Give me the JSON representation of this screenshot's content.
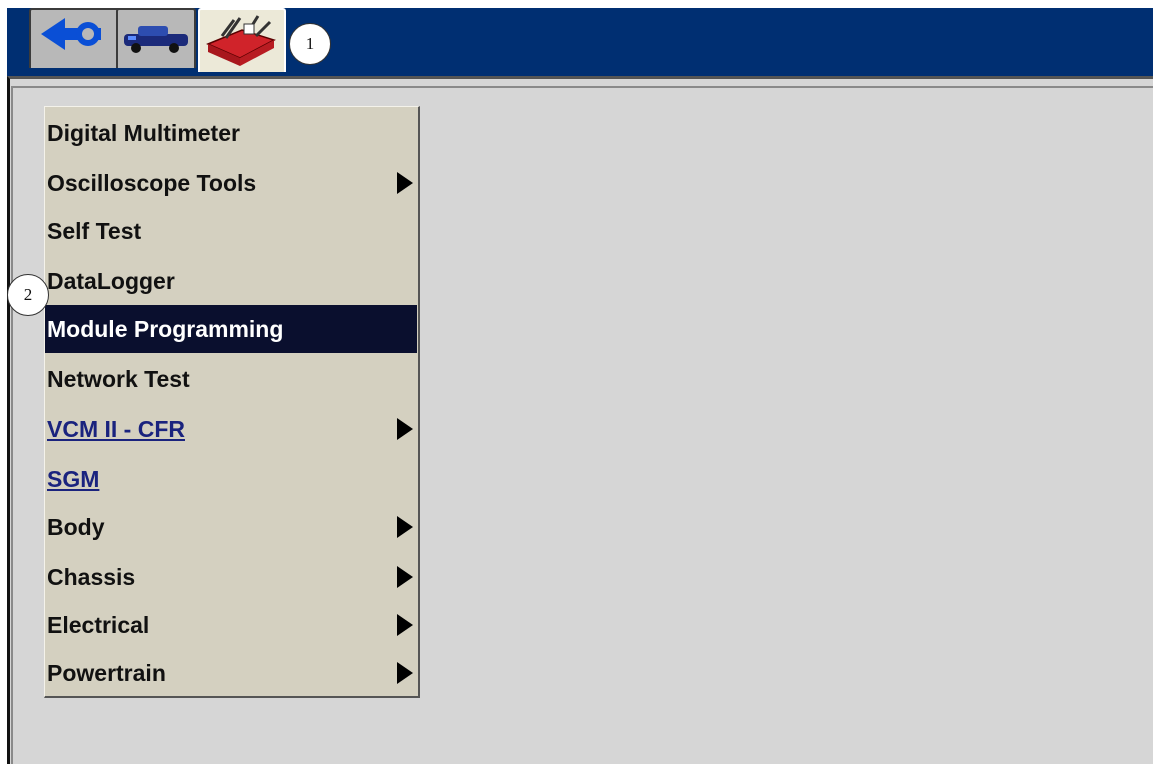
{
  "tabs": [
    {
      "name": "back",
      "icon": "back-arrow-icon",
      "active": false
    },
    {
      "name": "vehicle",
      "icon": "vehicle-icon",
      "active": false
    },
    {
      "name": "toolbox",
      "icon": "toolbox-icon",
      "active": true
    }
  ],
  "callouts": {
    "one": "1",
    "two": "2"
  },
  "menu": {
    "items": [
      {
        "label": "Digital Multimeter",
        "submenu": false,
        "link": false,
        "selected": false
      },
      {
        "label": "Oscilloscope Tools",
        "submenu": true,
        "link": false,
        "selected": false
      },
      {
        "label": "Self Test",
        "submenu": false,
        "link": false,
        "selected": false
      },
      {
        "label": "DataLogger",
        "submenu": false,
        "link": false,
        "selected": false
      },
      {
        "label": "Module Programming",
        "submenu": false,
        "link": false,
        "selected": true
      },
      {
        "label": "Network Test",
        "submenu": false,
        "link": false,
        "selected": false
      },
      {
        "label": "VCM II - CFR",
        "submenu": true,
        "link": true,
        "selected": false
      },
      {
        "label": "SGM",
        "submenu": false,
        "link": true,
        "selected": false
      },
      {
        "label": "Body",
        "submenu": true,
        "link": false,
        "selected": false
      },
      {
        "label": "Chassis",
        "submenu": true,
        "link": false,
        "selected": false
      },
      {
        "label": "Electrical",
        "submenu": true,
        "link": false,
        "selected": false
      },
      {
        "label": "Powertrain",
        "submenu": true,
        "link": false,
        "selected": false
      }
    ]
  },
  "colors": {
    "topbar": "#002f72",
    "menu_bg": "#d4d0c0",
    "selected_bg": "#0a0f2e",
    "link": "#1a237e",
    "toolbox_red": "#d0232a"
  }
}
